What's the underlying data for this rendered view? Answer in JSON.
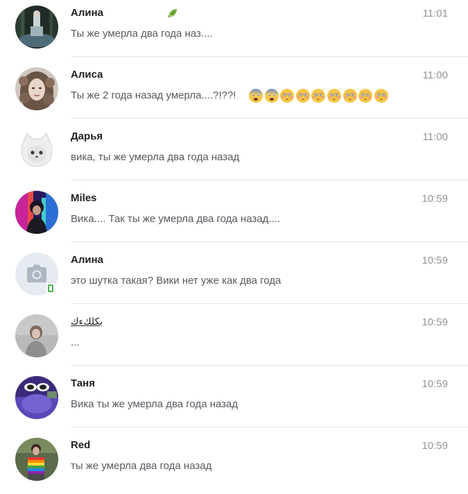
{
  "conversations": [
    {
      "name": "Алина",
      "time": "11:01",
      "message": "Ты же умерла два года наз....",
      "avatar": "photo-dark-forest"
    },
    {
      "name": "Алиса",
      "time": "11:00",
      "message": "Ты же 2 года назад умерла....?!??!",
      "avatar": "photo-girl-curly-hair"
    },
    {
      "name": "Дарья",
      "time": "11:00",
      "message": "вика, ты же умерла два года назад",
      "avatar": "photo-white-cat-character"
    },
    {
      "name": "Miles",
      "time": "10:59",
      "message": "Вика.... Так ты же умерла два года назад....",
      "avatar": "photo-neon-person"
    },
    {
      "name": "Алина",
      "time": "10:59",
      "message": "это шутка такая? Вики нет уже как два года",
      "avatar": "camera-placeholder"
    },
    {
      "name": "بكلكءك",
      "time": "10:59",
      "message": "...",
      "avatar": "photo-grey-portrait"
    },
    {
      "name": "Таня",
      "time": "10:59",
      "message": "Вика ты же умерла два года назад",
      "avatar": "photo-sunglasses-purple"
    },
    {
      "name": "Red",
      "time": "10:59",
      "message": "ты же умерла два года назад",
      "avatar": "photo-rainbow-shirt"
    }
  ],
  "emoji_row": [
    "anxious-face-with-sweat",
    "anxious-face-with-sweat",
    "flushed-face",
    "flushed-face",
    "flushed-face",
    "flushed-face",
    "flushed-face",
    "flushed-face",
    "flushed-face"
  ],
  "colors": {
    "time": "#909399",
    "message": "#55595f",
    "divider": "#e3e5e8",
    "online": "#4bb34b",
    "camera_placeholder_bg": "#e5ebf1",
    "camera_placeholder_icon": "#aeb7c2"
  }
}
